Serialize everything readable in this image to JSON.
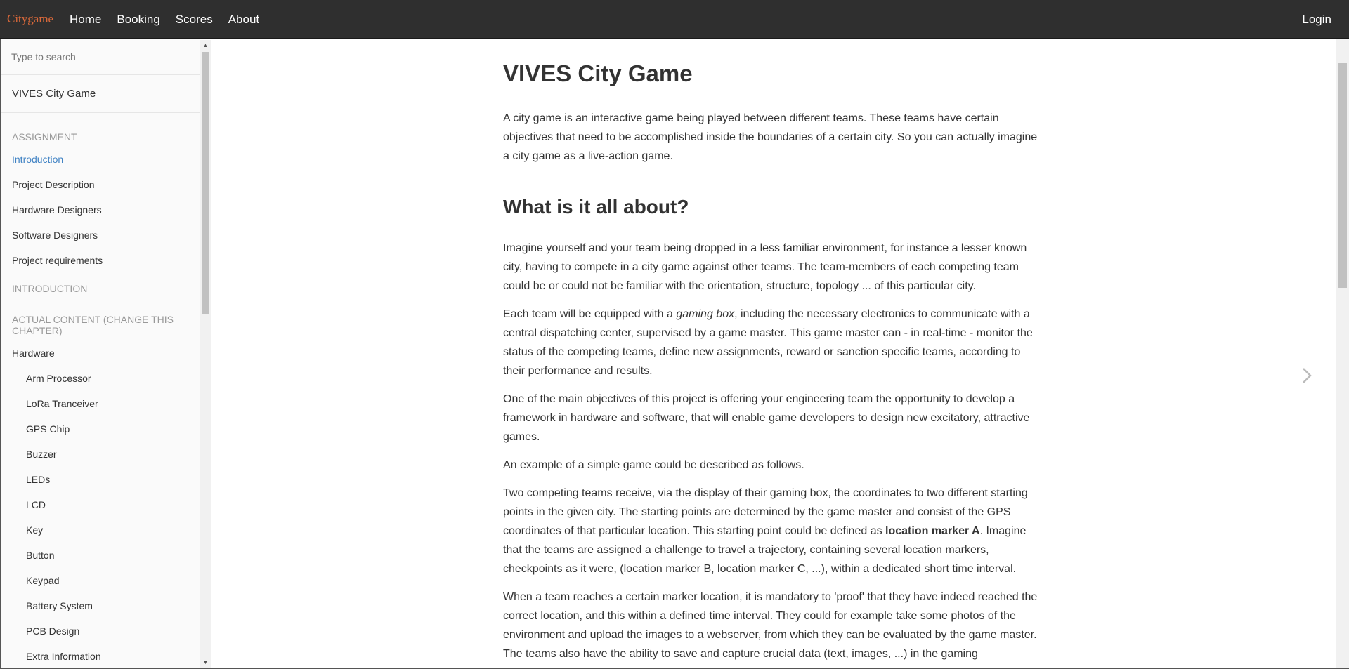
{
  "navbar": {
    "brand": "Citygame",
    "links": [
      "Home",
      "Booking",
      "Scores",
      "About"
    ],
    "login": "Login"
  },
  "sidebar": {
    "search_placeholder": "Type to search",
    "book_title": "VIVES City Game",
    "sections": [
      {
        "header": "ASSIGNMENT",
        "items": [
          {
            "label": "Introduction",
            "active": true
          },
          {
            "label": "Project Description"
          },
          {
            "label": "Hardware Designers"
          },
          {
            "label": "Software Designers"
          },
          {
            "label": "Project requirements"
          }
        ]
      },
      {
        "header": "INTRODUCTION",
        "items": []
      },
      {
        "header": "ACTUAL CONTENT (CHANGE THIS CHAPTER)",
        "items": [
          {
            "label": "Hardware"
          },
          {
            "label": "Arm Processor",
            "sub": true
          },
          {
            "label": "LoRa Tranceiver",
            "sub": true
          },
          {
            "label": "GPS Chip",
            "sub": true
          },
          {
            "label": "Buzzer",
            "sub": true
          },
          {
            "label": "LEDs",
            "sub": true
          },
          {
            "label": "LCD",
            "sub": true
          },
          {
            "label": "Key",
            "sub": true
          },
          {
            "label": "Button",
            "sub": true
          },
          {
            "label": "Keypad",
            "sub": true
          },
          {
            "label": "Battery System",
            "sub": true
          },
          {
            "label": "PCB Design",
            "sub": true
          },
          {
            "label": "Extra Information",
            "sub": true
          }
        ]
      }
    ]
  },
  "content": {
    "title": "VIVES City Game",
    "intro": "A city game is an interactive game being played between different teams. These teams have certain objectives that need to be accomplished inside the boundaries of a certain city. So you can actually imagine a city game as a live-action game.",
    "section_title": "What is it all about?",
    "p1": "Imagine yourself and your team being dropped in a less familiar environment, for instance a lesser known city, having to compete in a city game against other teams. The team-members of each competing team could be or could not be familiar with the orientation, structure, topology ... of this particular city.",
    "p2_before": "Each team will be equipped with a ",
    "p2_em": "gaming box",
    "p2_after": ", including the necessary electronics to communicate with a central dispatching center, supervised by a game master. This game master can - in real-time - monitor the status of the competing teams, define new assignments, reward or sanction specific teams, according to their performance and results.",
    "p3": "One of the main objectives of this project is offering your engineering team the opportunity to develop a framework in hardware and software, that will enable game developers to design new excitatory, attractive games.",
    "p4": "An example of a simple game could be described as follows.",
    "p5_before": "Two competing teams receive, via the display of their gaming box, the coordinates to two different starting points in the given city. The starting points are determined by the game master and consist of the GPS coordinates of that particular location. This starting point could be defined as ",
    "p5_strong": "location marker A",
    "p5_after": ". Imagine that the teams are assigned a challenge to travel a trajectory, containing several location markers, checkpoints as it were, (location marker B, location marker C, ...), within a dedicated short time interval.",
    "p6": "When a team reaches a certain marker location, it is mandatory to 'proof' that they have indeed reached the correct location, and this within a defined time interval. They could for example take some photos of the environment and upload the images to a webserver, from which they can be evaluated by the game master. The teams also have the ability to save and capture crucial data (text, images, ...) in the gaming"
  },
  "colors": {
    "navbar_bg": "#2f2f2f",
    "brand": "#d8683a",
    "active_link": "#4183c4",
    "section_header": "#999999"
  },
  "icons": {
    "next_page": "chevron-right-icon"
  }
}
